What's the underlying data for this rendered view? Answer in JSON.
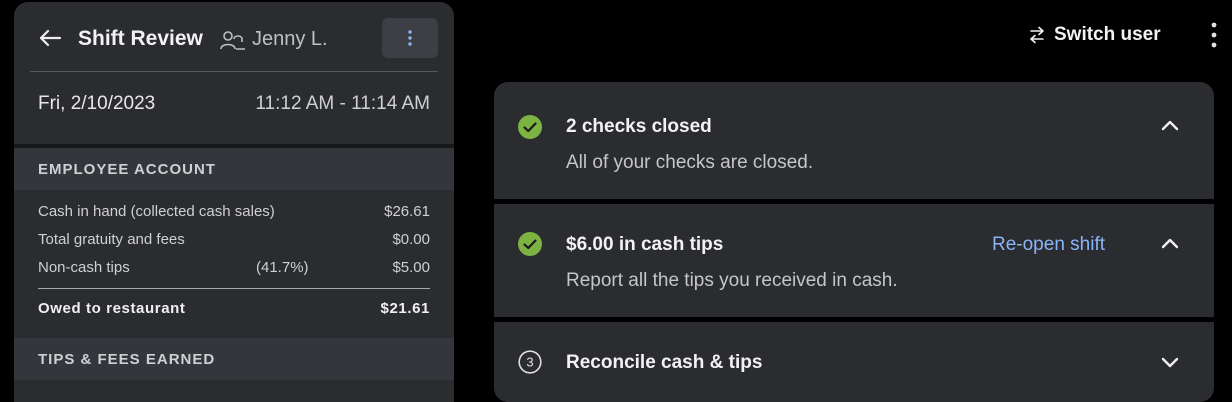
{
  "header": {
    "title": "Shift Review",
    "employee": "Jenny L.",
    "date": "Fri, 2/10/2023",
    "time_range": "11:12 AM - 11:14 AM"
  },
  "employee_account": {
    "heading": "EMPLOYEE ACCOUNT",
    "rows": [
      {
        "label": "Cash in hand (collected cash sales)",
        "pct": "",
        "value": "$26.61"
      },
      {
        "label": "Total gratuity and fees",
        "pct": "",
        "value": "$0.00"
      },
      {
        "label": "Non-cash tips",
        "pct": "(41.7%)",
        "value": "$5.00"
      }
    ],
    "owed_label": "Owed to restaurant",
    "owed_value": "$21.61"
  },
  "tips_section": {
    "heading": "TIPS & FEES EARNED"
  },
  "top_bar": {
    "switch_user": "Switch user"
  },
  "steps": [
    {
      "title": "2 checks closed",
      "subtitle": "All of your checks are closed.",
      "status": "complete",
      "expanded": true
    },
    {
      "title": "$6.00 in cash tips",
      "subtitle": "Report all the tips you received in cash.",
      "status": "complete",
      "expanded": true,
      "action": "Re-open shift"
    },
    {
      "title": "Reconcile cash & tips",
      "number": "3",
      "status": "pending",
      "expanded": false
    }
  ],
  "colors": {
    "accent": "#8ab4f8",
    "success": "#7cb342",
    "panel": "#2b2c30"
  }
}
